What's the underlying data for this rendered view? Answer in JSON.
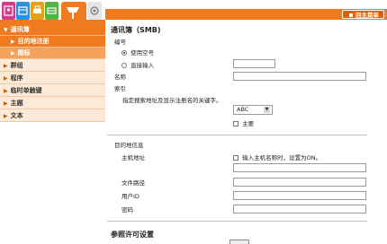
{
  "header": {
    "back_label": "回主菜单"
  },
  "icon_tabs": [
    {
      "name": "user-mode-icon",
      "color": "#d23c8a"
    },
    {
      "name": "box-icon",
      "color": "#2f8fd8"
    },
    {
      "name": "print-icon",
      "color": "#e5a11c"
    },
    {
      "name": "scan-icon",
      "color": "#59b043"
    },
    {
      "name": "fax-icon",
      "color": "#f07a20"
    },
    {
      "name": "store-address-icon",
      "color": "#9a9a9a"
    }
  ],
  "sidebar": {
    "items": [
      {
        "label": "通讯簿",
        "open": true
      },
      {
        "label": "群组"
      },
      {
        "label": "程序"
      },
      {
        "label": "临时单触键"
      },
      {
        "label": "主题"
      },
      {
        "label": "文本"
      }
    ],
    "subitems": [
      {
        "label": "目的地注册"
      },
      {
        "label": "图标"
      }
    ]
  },
  "form": {
    "title": "通讯簿（SMB)",
    "number_label": "编号",
    "radio_use_free": "使用空号",
    "radio_direct": "直接输入",
    "name_label": "名称",
    "index_label": "索引",
    "index_hint": "指定搜索地址及显示注册名的关键字。",
    "index_value": "ABC",
    "main_label": "主要",
    "dest_info_title": "目的地信息",
    "host_label": "主机地址",
    "host_check_label": "输入主机名称时，设置为ON。",
    "path_label": "文件路径",
    "user_label": "用户ID",
    "password_label": "密码",
    "ref_title": "参照许可设置"
  }
}
